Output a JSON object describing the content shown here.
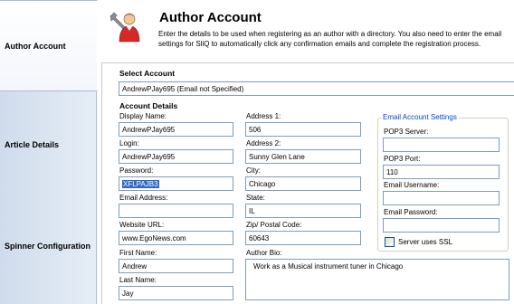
{
  "sidebar": {
    "items": [
      {
        "label": "Author Account"
      },
      {
        "label": "Article Details"
      },
      {
        "label": "Spinner Configuration"
      }
    ]
  },
  "header": {
    "title": "Author Account",
    "description": "Enter the details to be used when registering as an author with a directory. You also need to enter the email settings for SliQ to automatically click any confirmation emails and complete the registration process.",
    "icon": "author-settings-icon"
  },
  "form": {
    "select_account_label": "Select Account",
    "select_account_value": "AndrewPJay695 (Email not Specified)",
    "account_details_label": "Account Details",
    "display_name": {
      "label": "Display Name:",
      "value": "AndrewPJay695"
    },
    "login": {
      "label": "Login:",
      "value": "AndrewPJay695"
    },
    "password": {
      "label": "Password:",
      "value": "XFLPAJB3"
    },
    "email_address": {
      "label": "Email Address:",
      "value": ""
    },
    "website_url": {
      "label": "Website URL:",
      "value": "www.EgoNews.com"
    },
    "first_name": {
      "label": "First Name:",
      "value": "Andrew"
    },
    "last_name": {
      "label": "Last Name:",
      "value": "Jay"
    },
    "address1": {
      "label": "Address 1:",
      "value": "506"
    },
    "address2": {
      "label": "Address 2:",
      "value": "Sunny Glen Lane"
    },
    "city": {
      "label": "City:",
      "value": "Chicago"
    },
    "state": {
      "label": "State:",
      "value": "IL"
    },
    "zip": {
      "label": "Zip/ Postal Code:",
      "value": "60643"
    },
    "author_bio": {
      "label": "Author Bio:",
      "value": "Work as a Musical instrument tuner in Chicago"
    }
  },
  "email_settings": {
    "title": "Email Account Settings",
    "pop3_server": {
      "label": "POP3 Server:",
      "value": ""
    },
    "pop3_port": {
      "label": "POP3 Port:",
      "value": "110"
    },
    "email_username": {
      "label": "Email Username:",
      "value": ""
    },
    "email_password": {
      "label": "Email Password:",
      "value": ""
    },
    "ssl_label": "Server uses SSL",
    "ssl_checked": false
  }
}
